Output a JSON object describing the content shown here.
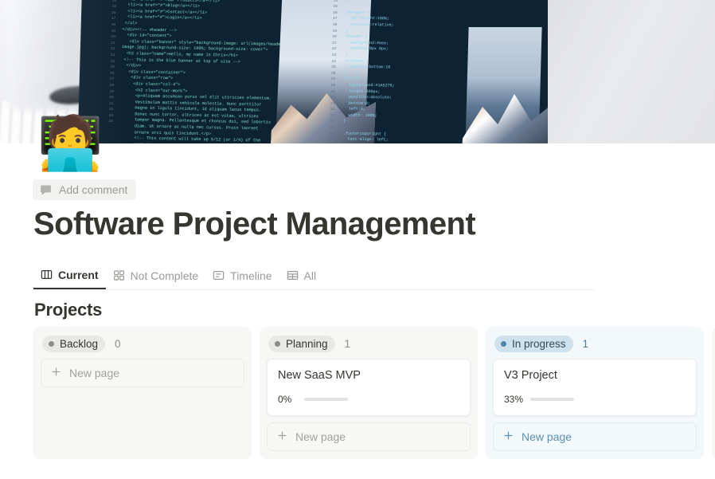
{
  "cover": {
    "name": "page-cover-image",
    "description": "Blurred photo of a desk with a monitor displaying HTML and CSS source code, a mug and keyboard on the left and a mountain wallpaper on the screen"
  },
  "page_icon": {
    "name": "man-technologist-emoji",
    "glyph": "🧑‍💻"
  },
  "add_comment": {
    "label": "Add comment",
    "icon": "comment-bubble-icon"
  },
  "page_title": "Software Project Management",
  "tabs": [
    {
      "label": "Current",
      "icon": "board-view-icon",
      "active": true
    },
    {
      "label": "Not Complete",
      "icon": "gallery-view-icon",
      "active": false
    },
    {
      "label": "Timeline",
      "icon": "timeline-view-icon",
      "active": false
    },
    {
      "label": "All",
      "icon": "table-view-icon",
      "active": false
    }
  ],
  "section_title": "Projects",
  "new_page_label": "New page",
  "colors": {
    "accent_blue": "#4f85a8",
    "pill_gray": "#e8e8e6",
    "pill_blue": "#cfe1ec",
    "column_gray": "#f7f7f6",
    "column_blue": "#f3f8fb",
    "progress_green": "#5f8d6b",
    "progress_track": "#e3e2e0",
    "text_primary": "#37352f",
    "text_muted": "#9b9a97"
  },
  "board": {
    "columns": [
      {
        "status": "Backlog",
        "count": "0",
        "accent": "gray",
        "cards": []
      },
      {
        "status": "Planning",
        "count": "1",
        "accent": "gray",
        "cards": [
          {
            "title": "New SaaS MVP",
            "progress_label": "0%",
            "progress_value": 0
          }
        ]
      },
      {
        "status": "In progress",
        "count": "1",
        "accent": "blue",
        "cards": [
          {
            "title": "V3 Project",
            "progress_label": "33%",
            "progress_value": 33
          }
        ]
      },
      {
        "status": "",
        "count": "",
        "accent": "gray",
        "cards": []
      }
    ]
  }
}
